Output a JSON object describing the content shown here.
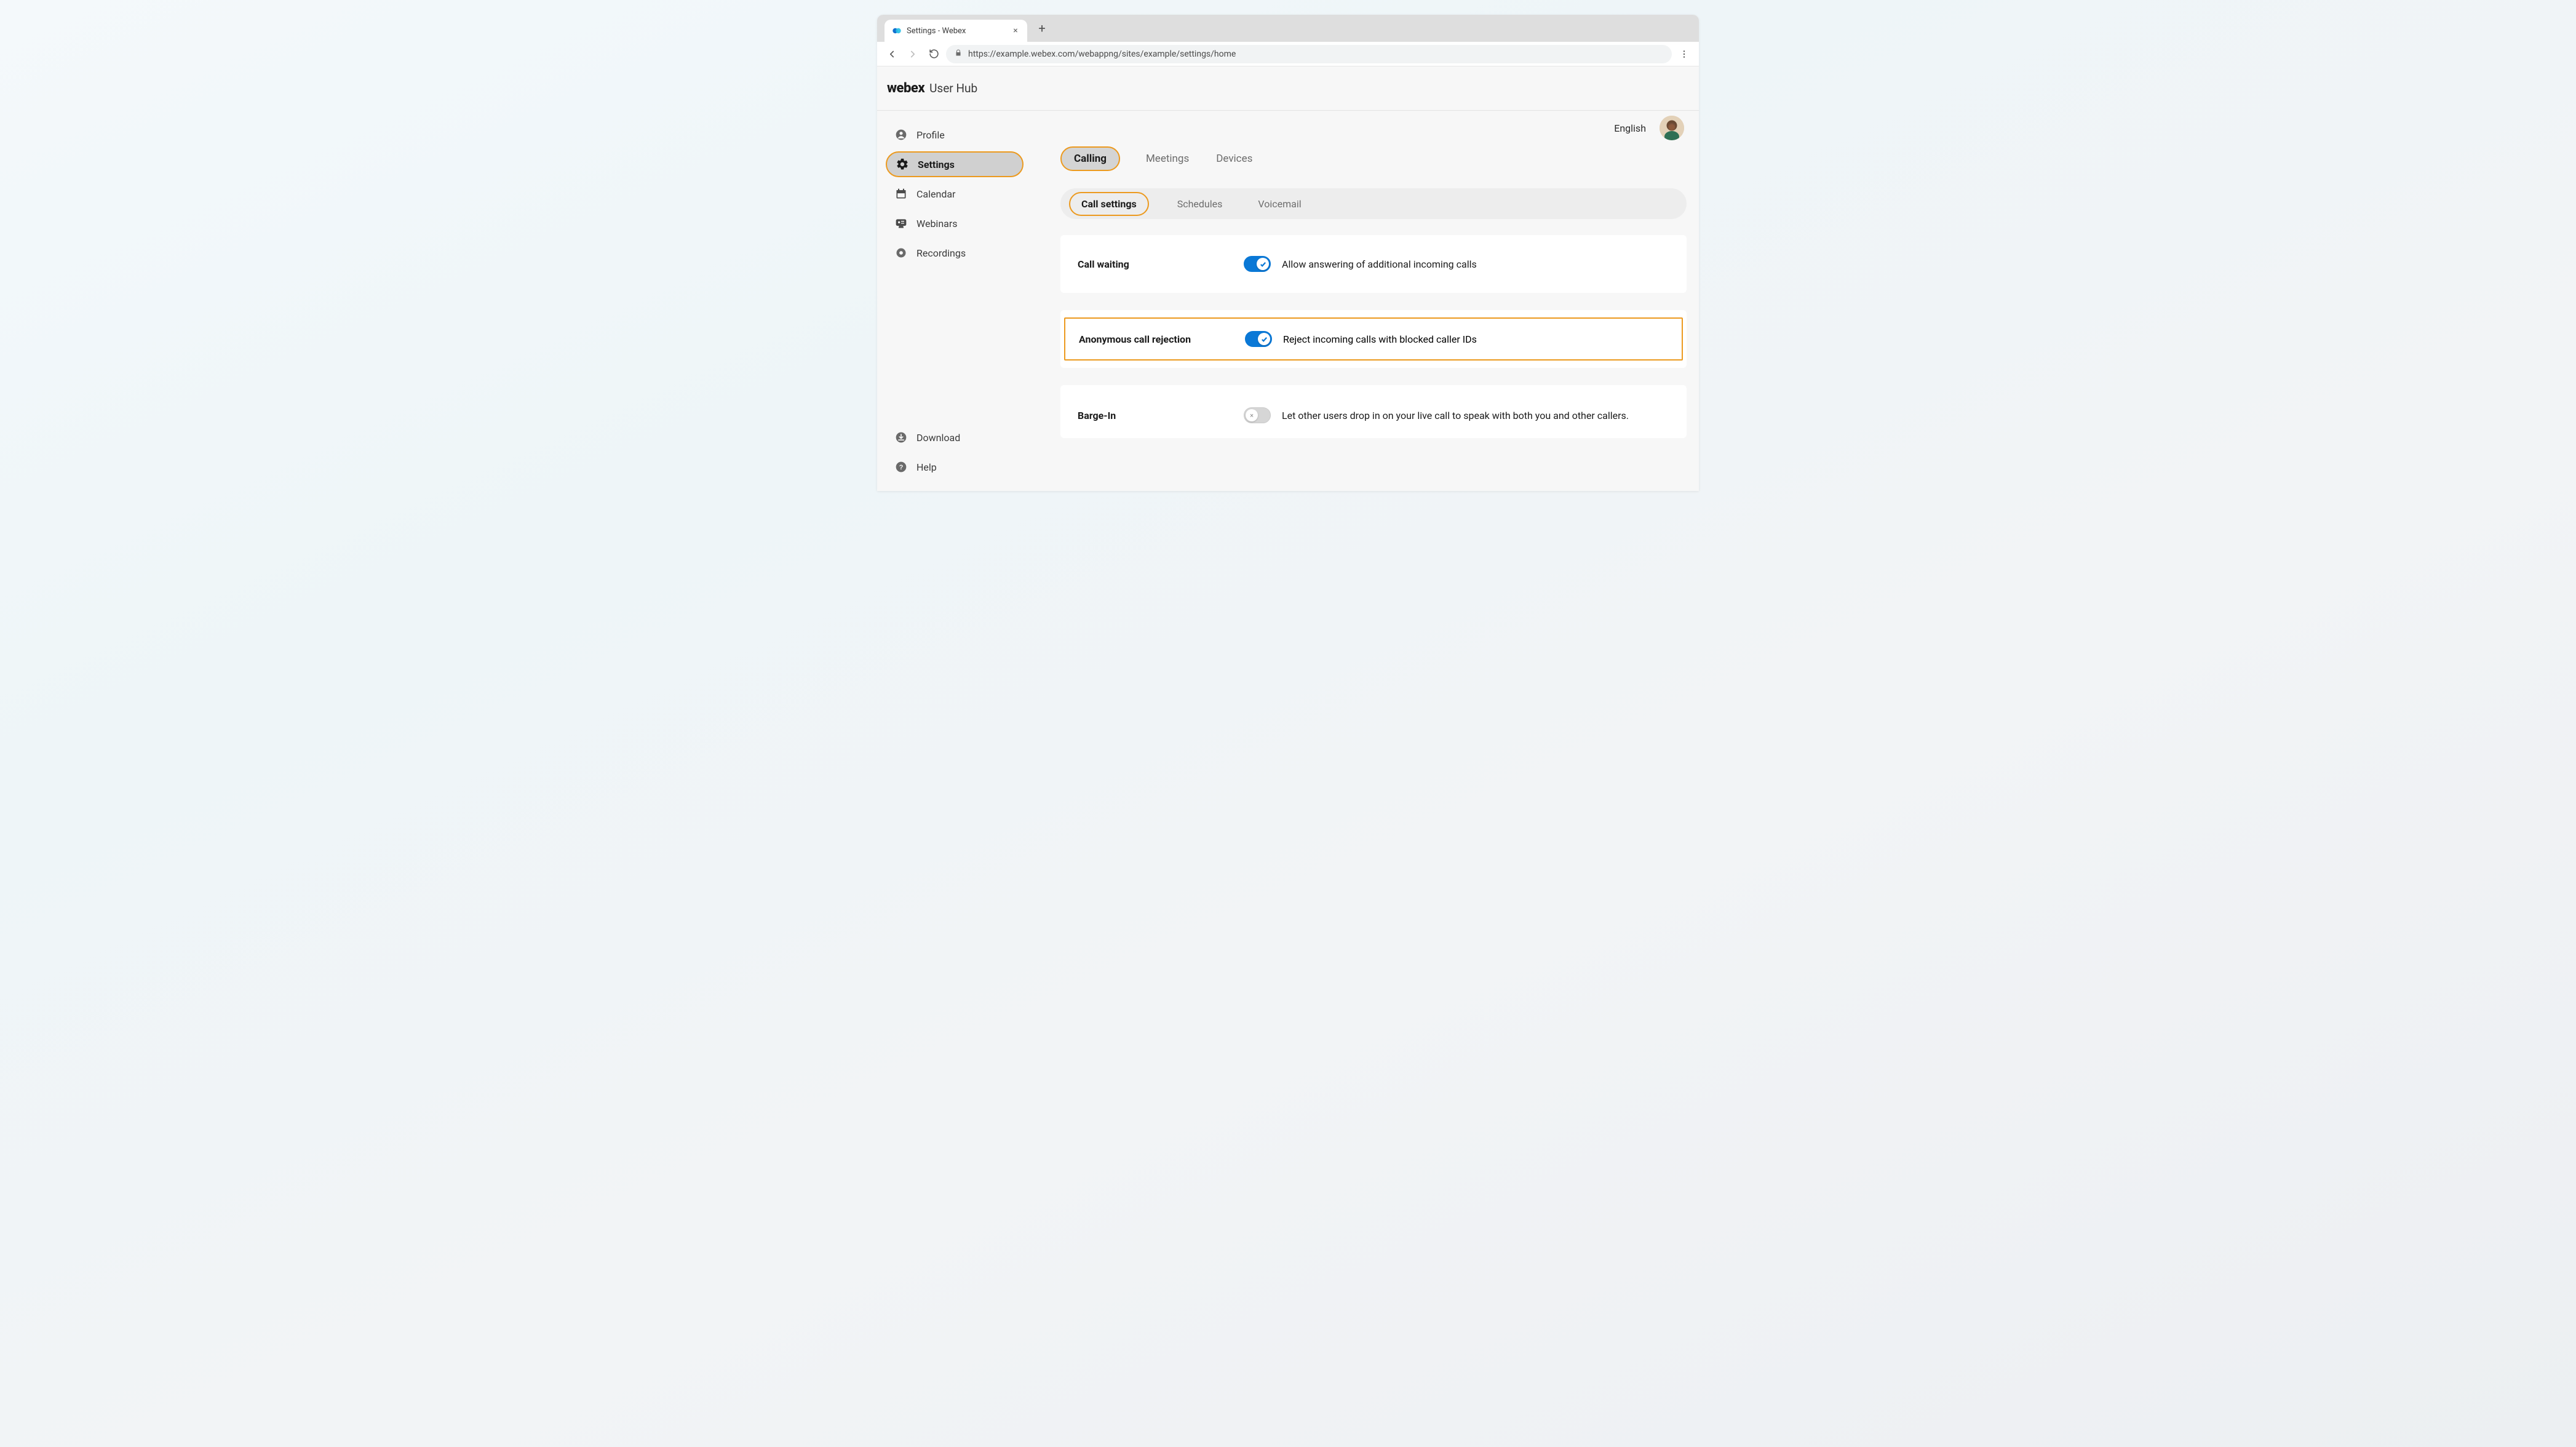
{
  "browser": {
    "tab_title": "Settings - Webex",
    "url": "https://example.webex.com/webappng/sites/example/settings/home"
  },
  "app": {
    "brand": "webex",
    "product": "User Hub",
    "language": "English"
  },
  "sidebar": {
    "items": [
      {
        "label": "Profile"
      },
      {
        "label": "Settings"
      },
      {
        "label": "Calendar"
      },
      {
        "label": "Webinars"
      },
      {
        "label": "Recordings"
      }
    ],
    "bottom": [
      {
        "label": "Download"
      },
      {
        "label": "Help"
      }
    ]
  },
  "tabs": {
    "primary": [
      {
        "label": "Calling"
      },
      {
        "label": "Meetings"
      },
      {
        "label": "Devices"
      }
    ],
    "secondary": [
      {
        "label": "Call settings"
      },
      {
        "label": "Schedules"
      },
      {
        "label": "Voicemail"
      }
    ]
  },
  "settings": {
    "call_waiting": {
      "title": "Call waiting",
      "description": "Allow answering of additional incoming calls",
      "on": true
    },
    "anon_reject": {
      "title": "Anonymous call rejection",
      "description": "Reject incoming calls with blocked caller IDs",
      "on": true
    },
    "barge_in": {
      "title": "Barge-In",
      "description": "Let other users drop in on your live call to speak with both you and other callers.",
      "on": false
    }
  }
}
